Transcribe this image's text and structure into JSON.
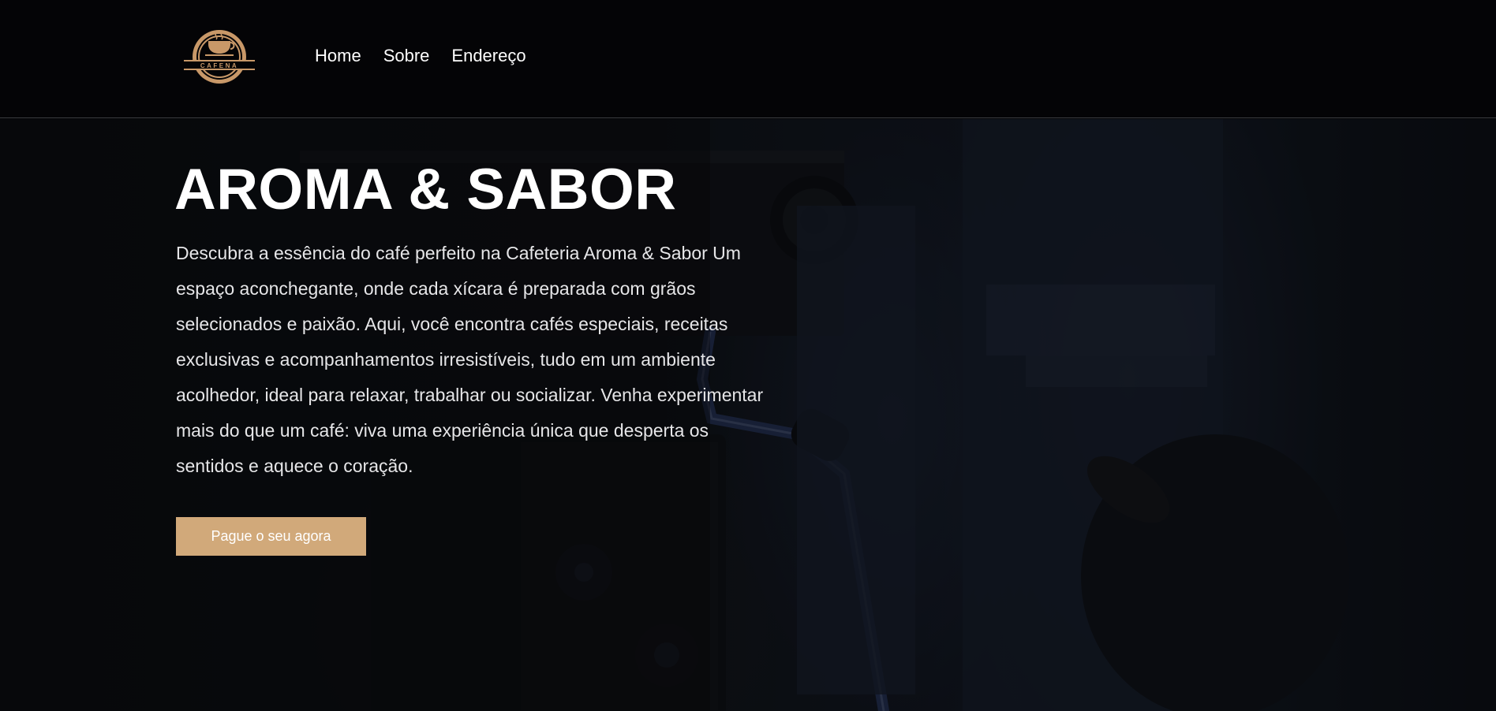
{
  "brand": {
    "logo_text": "CAFENA",
    "accent_color": "#d1a97a"
  },
  "nav": {
    "items": [
      {
        "label": "Home"
      },
      {
        "label": "Sobre"
      },
      {
        "label": "Endereço"
      }
    ]
  },
  "hero": {
    "title": "AROMA & SABOR",
    "description": "Descubra a essência do café perfeito na Cafeteria Aroma & Sabor Um espaço aconchegante, onde cada xícara é preparada com grãos selecionados e paixão. Aqui, você encontra cafés especiais, receitas exclusivas e acompanhamentos irresistíveis, tudo em um ambiente acolhedor, ideal para relaxar, trabalhar ou socializar. Venha experimentar mais do que um café: viva uma experiência única que desperta os sentidos e aquece o coração.",
    "cta_label": "Pague o seu agora"
  }
}
